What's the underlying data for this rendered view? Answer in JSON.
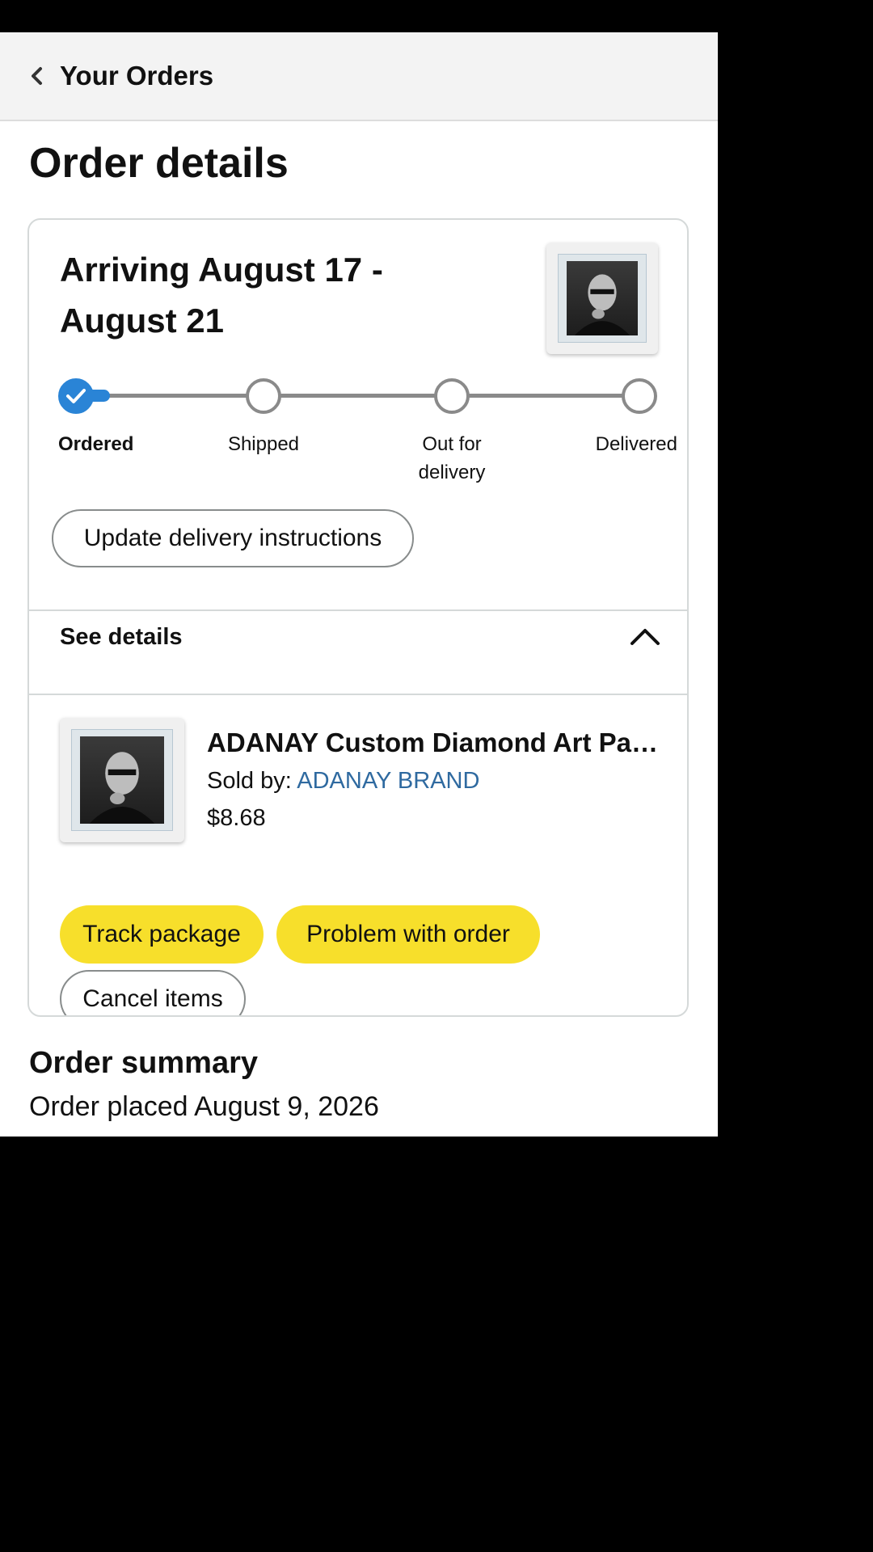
{
  "header": {
    "back_label": "Your Orders"
  },
  "page": {
    "title": "Order details"
  },
  "shipment": {
    "arriving": "Arriving August 17 - August 21",
    "steps": [
      {
        "label": "Ordered",
        "done": true
      },
      {
        "label": "Shipped",
        "done": false
      },
      {
        "label": "Out for delivery",
        "done": false
      },
      {
        "label": "Delivered",
        "done": false
      }
    ],
    "update_button": "Update delivery instructions"
  },
  "details": {
    "toggle_label": "See details",
    "item": {
      "title": "ADANAY Custom Diamond Art Painting Kits",
      "sold_by_prefix": "Sold by:",
      "seller": "ADANAY BRAND",
      "price": "$8.68"
    },
    "buttons": {
      "track": "Track package",
      "problem": "Problem with order",
      "cancel": "Cancel items"
    }
  },
  "summary": {
    "title": "Order summary",
    "placed": "Order placed August 9, 2026"
  },
  "colors": {
    "accent_blue": "#2a84d6",
    "button_yellow": "#f7df2b",
    "link_blue": "#2f6aa0"
  }
}
